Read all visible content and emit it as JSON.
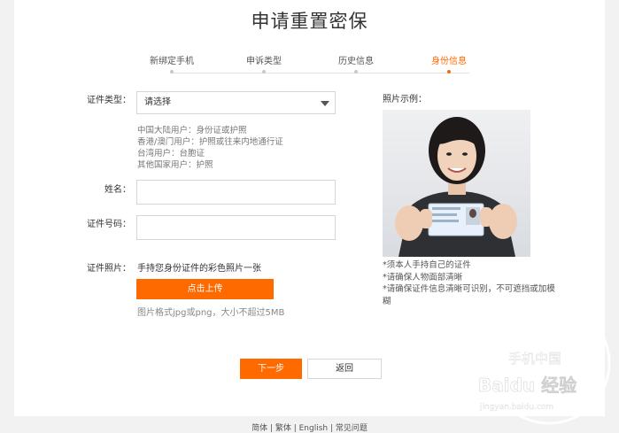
{
  "page": {
    "title": "申请重置密保"
  },
  "steps": [
    {
      "label": "新绑定手机",
      "active": false
    },
    {
      "label": "申诉类型",
      "active": false
    },
    {
      "label": "历史信息",
      "active": false
    },
    {
      "label": "身份信息",
      "active": true
    }
  ],
  "form": {
    "id_type": {
      "label": "证件类型：",
      "selected": "请选择",
      "hints": [
        "中国大陆用户：身份证或护照",
        "香港/澳门用户：护照或往来内地通行证",
        "台湾用户：台胞证",
        "其他国家用户：护照"
      ]
    },
    "name": {
      "label": "姓名：",
      "value": ""
    },
    "id_number": {
      "label": "证件号码：",
      "value": ""
    },
    "id_photo": {
      "label": "证件照片：",
      "description": "手持您身份证件的彩色照片一张",
      "upload_label": "点击上传",
      "tip": "图片格式jpg或png，大小不超过5MB"
    }
  },
  "example": {
    "title": "照片示例：",
    "notes": [
      "*须本人手持自己的证件",
      "*请确保人物面部清晰",
      "*请确保证件信息清晰可识别，不可遮挡或加模糊"
    ]
  },
  "actions": {
    "next_label": "下一步",
    "back_label": "返回"
  },
  "footer": {
    "text": "简体 | 繁体 | English | 常见问题"
  },
  "watermark": {
    "line1": "手机中国",
    "line2": "Baidu 经验",
    "line3": "jingyan.baidu.com"
  },
  "colors": {
    "accent": "#ff6a00",
    "background": "#f2f2f2"
  }
}
